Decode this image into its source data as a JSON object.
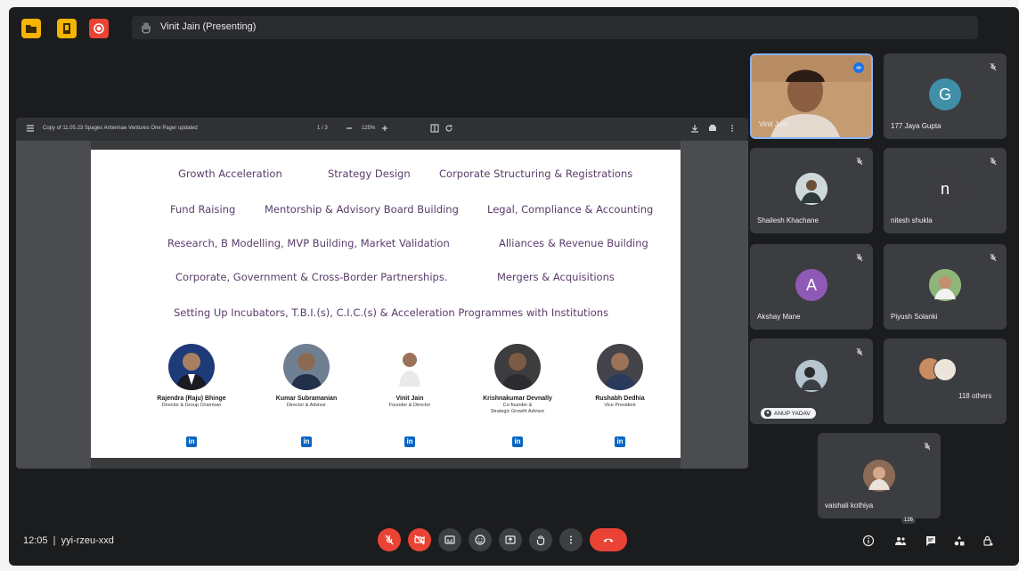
{
  "topbar": {
    "presenter_label": "Vinit Jain (Presenting)"
  },
  "viewer": {
    "document_title": "Copy of 11.05.23 Spages Antennae Ventures One Pager updated",
    "page_indicator": "1 / 3",
    "zoom": "125%"
  },
  "slide": {
    "services": [
      "Growth Acceleration",
      "Strategy Design",
      "Corporate Structuring & Registrations",
      "Fund Raising",
      "Mentorship & Advisory Board Building",
      "Legal, Compliance & Accounting",
      "Research, B Modelling, MVP Building, Market Validation",
      "Alliances & Revenue Building",
      "Corporate, Government & Cross-Border Partnerships.",
      "Mergers & Acquisitions",
      "Setting Up Incubators, T.B.I.(s), C.I.C.(s) & Acceleration Programmes with Institutions"
    ],
    "people": [
      {
        "name": "Rajendra (Raju) Bhinge",
        "role": "Director & Group Chairman"
      },
      {
        "name": "Kumar Subramanian",
        "role": "Director & Advisor"
      },
      {
        "name": "Vinit Jain",
        "role": "Founder & Director"
      },
      {
        "name": "Krishnakumar Devnally",
        "role": "Co-founder &\nStrategic Growth Advisor"
      },
      {
        "name": "Rushabh Dedhia",
        "role": "Vice President"
      }
    ],
    "linkedin_label": "in"
  },
  "participants": [
    {
      "name": "Vinit Jain"
    },
    {
      "name": "177 Jaya Gupta",
      "initial": "G"
    },
    {
      "name": "Shailesh Khachane"
    },
    {
      "name": "nitesh shukla",
      "initial": "n"
    },
    {
      "name": "Akshay Mane",
      "initial": "A"
    },
    {
      "name": "Piyush Solanki"
    },
    {
      "name": "ANUP YADAV"
    },
    {
      "name": "118 others"
    },
    {
      "name": "vaishali kothiya"
    }
  ],
  "colors": {
    "avatar_G": "#3f8fa8",
    "avatar_n": "#3c3d40",
    "avatar_A": "#8e5ab5",
    "end_call": "#ea4335"
  },
  "bottombar": {
    "time": "12:05",
    "meeting_code": "yyi-rzeu-xxd",
    "participant_count": "126"
  }
}
